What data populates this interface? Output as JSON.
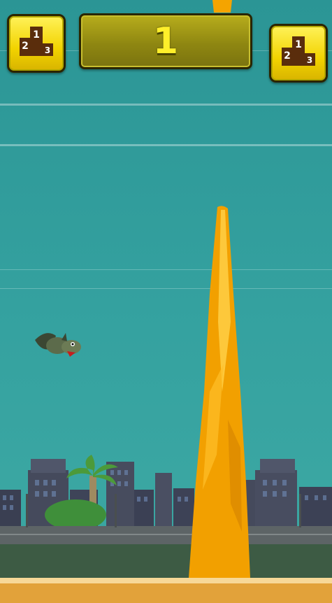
{
  "hud": {
    "score": "1",
    "leaderboard_left": {
      "digits": [
        "1",
        "2",
        "3"
      ]
    },
    "leaderboard_right": {
      "digits": [
        "1",
        "2",
        "3"
      ]
    }
  },
  "colors": {
    "sky": "#2f9a9a",
    "pillar": "#f5a400",
    "button": "#f2d300",
    "score_panel": "#8f8711",
    "score_text": "#ffef2a"
  },
  "icons": [
    "podium-icon",
    "podium-icon",
    "dragon-icon"
  ]
}
